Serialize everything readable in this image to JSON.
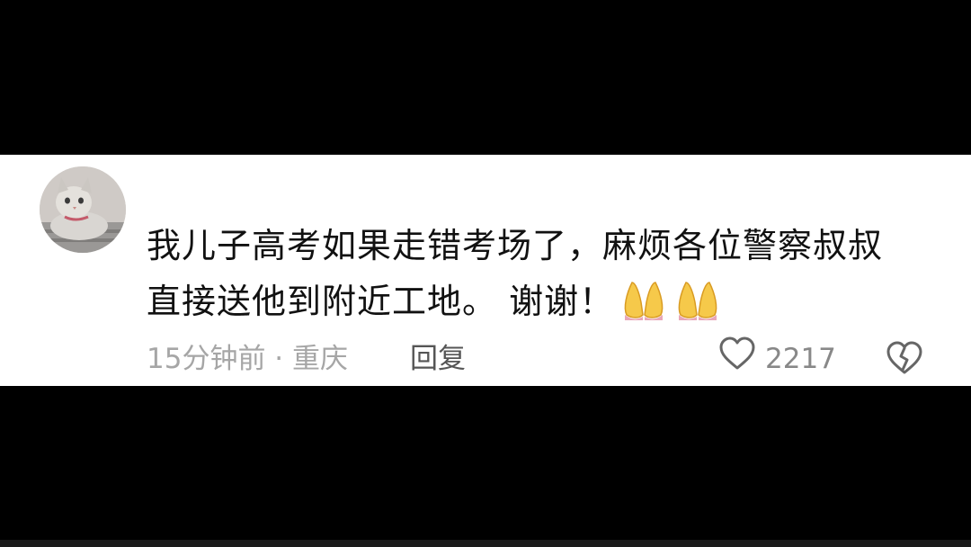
{
  "comment": {
    "avatar_icon": "cat-avatar",
    "text_line1": "我儿子高考如果走错考场了，麻烦各位警察叔叔",
    "text_line2": "直接送他到附近工地。 谢谢！",
    "emoji_icon": "folded-hands-icon",
    "meta": {
      "time_location": "15分钟前 · 重庆",
      "reply_label": "回复",
      "like_count": "2217",
      "like_icon": "heart-outline-icon",
      "dislike_icon": "broken-heart-icon"
    }
  },
  "colors": {
    "background": "#000000",
    "card": "#ffffff",
    "text": "#111111",
    "meta_text": "#a6a6a6",
    "reply_text": "#555555"
  }
}
